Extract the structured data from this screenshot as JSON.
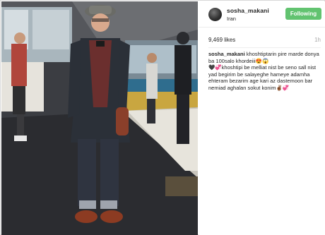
{
  "post": {
    "username": "sosha_makani",
    "location": "Iran",
    "follow_label": "Following",
    "likes": "9,469 likes",
    "age": "1h"
  },
  "caption": {
    "username": "sosha_makani",
    "line1": "khoshtiptarin pire marde donya ba 100salo khordeiii😍😱",
    "line2": "🖤💞khoshtipi be melliat nist be seno sall nist yad begirim be salayeghe hameye adamha ehteram bezarim age kari az dastemoon bar nemiad aghalan sokut konim✌🏾💞"
  },
  "colors": {
    "follow_bg": "#62c370",
    "text": "#262626",
    "muted": "#a8a8a8"
  }
}
